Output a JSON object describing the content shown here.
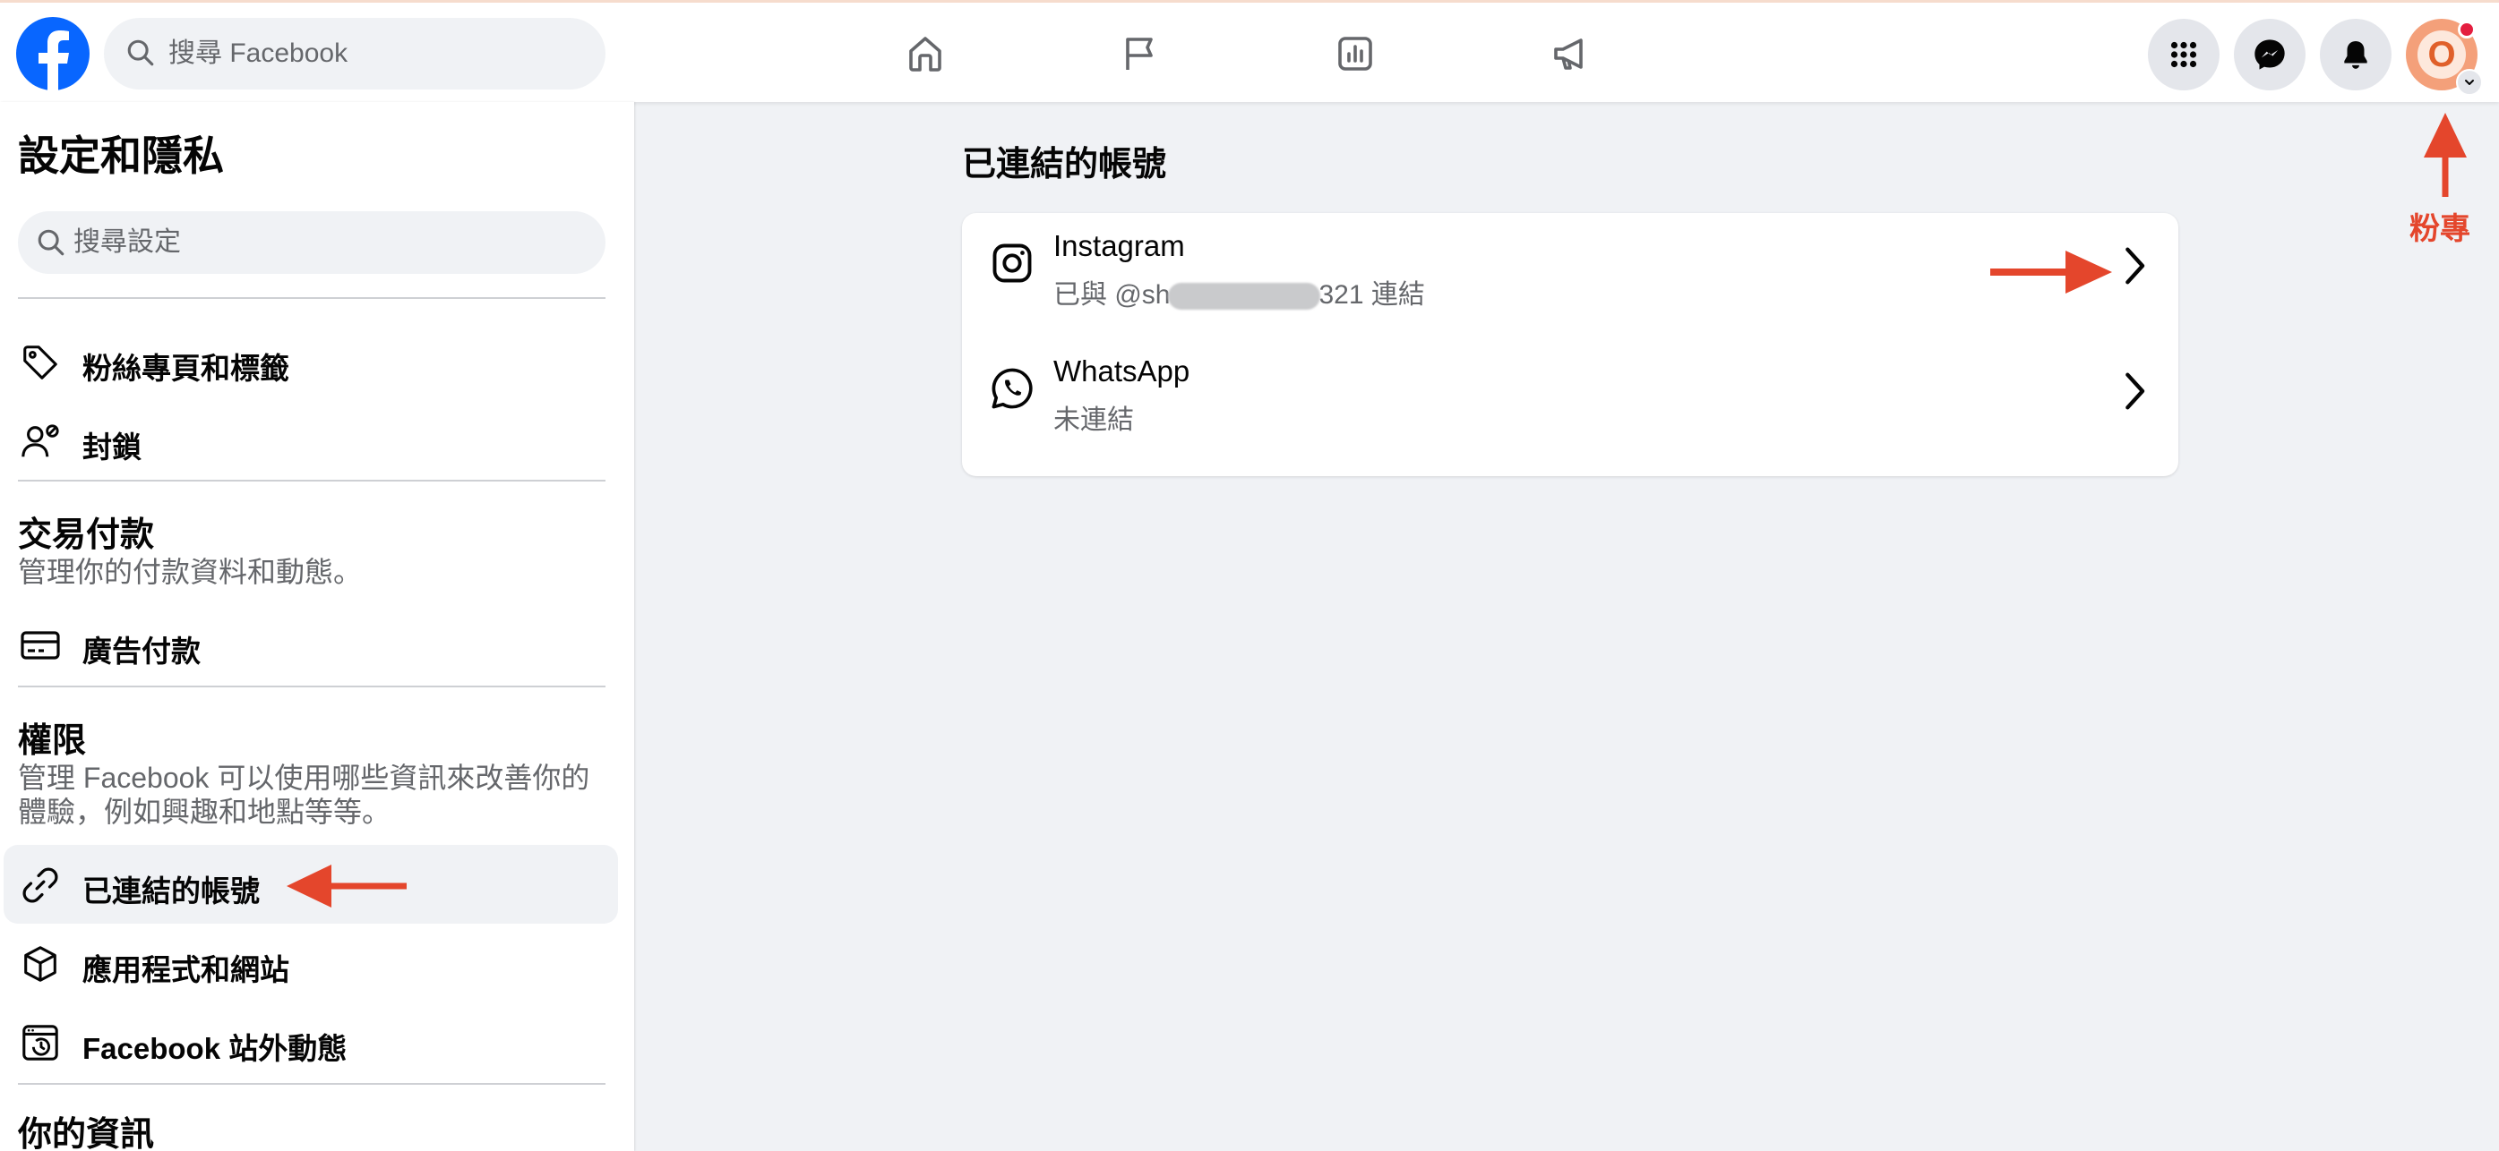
{
  "topbar": {
    "search_placeholder": "搜尋 Facebook",
    "nav_icons": [
      "home-icon",
      "flag-icon",
      "insights-icon",
      "megaphone-icon"
    ],
    "right_icons": [
      "apps-grid-icon",
      "messenger-icon",
      "bell-icon"
    ],
    "avatar_letter": "O"
  },
  "sidebar": {
    "title": "設定和隱私",
    "search_placeholder": "搜尋設定",
    "items_top": [
      {
        "label": "粉絲專頁和標籤",
        "icon": "tag-icon"
      },
      {
        "label": "封鎖",
        "icon": "block-user-icon"
      }
    ],
    "payments": {
      "title": "交易付款",
      "desc": "管理你的付款資料和動態。",
      "item": {
        "label": "廣告付款",
        "icon": "credit-card-icon"
      }
    },
    "permissions": {
      "title": "權限",
      "desc": "管理 Facebook 可以使用哪些資訊來改善你的體驗，例如興趣和地點等等。",
      "items": [
        {
          "label": "已連結的帳號",
          "icon": "link-icon",
          "active": true
        },
        {
          "label": "應用程式和網站",
          "icon": "cube-icon"
        },
        {
          "label": "Facebook 站外動態",
          "icon": "history-icon"
        }
      ]
    },
    "your_info_title": "你的資訊"
  },
  "main": {
    "title": "已連結的帳號",
    "accounts": [
      {
        "name": "Instagram",
        "status_prefix": "已與 @sh",
        "status_suffix": "321 連結",
        "icon": "instagram-icon"
      },
      {
        "name": "WhatsApp",
        "status": "未連結",
        "icon": "whatsapp-icon"
      }
    ]
  },
  "annotation": {
    "label": "粉專",
    "color": "#e4462c"
  },
  "colors": {
    "brand": "#0866ff",
    "background": "#f0f2f5",
    "secondary_text": "#65676b"
  }
}
